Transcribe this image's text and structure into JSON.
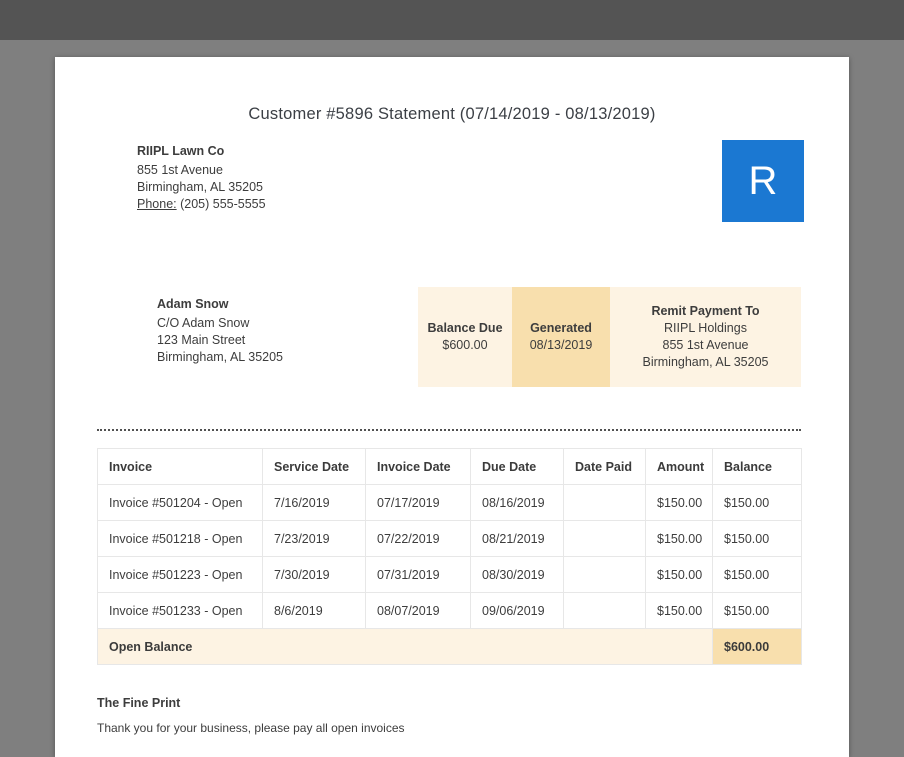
{
  "colors": {
    "viewer_background": "#7f7f7f",
    "viewer_topbar": "#545454",
    "logo_blue": "#1b78d2",
    "highlight_light": "#fdf3e3",
    "highlight_dark": "#f8dfad"
  },
  "document": {
    "title": "Customer #5896 Statement (07/14/2019 - 08/13/2019)",
    "company": {
      "name": "RIIPL Lawn Co",
      "address_line1": "855 1st Avenue",
      "address_line2": "Birmingham, AL 35205",
      "phone_label": "Phone:",
      "phone_value": " (205) 555-5555"
    },
    "logo_letter": "R",
    "customer": {
      "name": "Adam Snow",
      "line1": "C/O Adam Snow",
      "line2": "123 Main Street",
      "line3": "Birmingham, AL 35205"
    },
    "summary": {
      "balance_due_label": "Balance Due",
      "balance_due_value": "$600.00",
      "generated_label": "Generated",
      "generated_value": "08/13/2019",
      "remit_label": "Remit Payment To",
      "remit_line1": "RIIPL Holdings",
      "remit_line2": "855 1st Avenue",
      "remit_line3": "Birmingham, AL 35205"
    },
    "table": {
      "headers": [
        "Invoice",
        "Service Date",
        "Invoice Date",
        "Due Date",
        "Date Paid",
        "Amount",
        "Balance"
      ],
      "rows": [
        [
          "Invoice #501204 - Open",
          "7/16/2019",
          "07/17/2019",
          "08/16/2019",
          "",
          "$150.00",
          "$150.00"
        ],
        [
          "Invoice #501218 - Open",
          "7/23/2019",
          "07/22/2019",
          "08/21/2019",
          "",
          "$150.00",
          "$150.00"
        ],
        [
          "Invoice #501223 - Open",
          "7/30/2019",
          "07/31/2019",
          "08/30/2019",
          "",
          "$150.00",
          "$150.00"
        ],
        [
          "Invoice #501233 - Open",
          "8/6/2019",
          "08/07/2019",
          "09/06/2019",
          "",
          "$150.00",
          "$150.00"
        ]
      ],
      "footer_label": "Open Balance",
      "footer_total": "$600.00"
    },
    "fine_print_title": "The Fine Print",
    "fine_print_text": "Thank you for your business, please pay all open invoices"
  }
}
